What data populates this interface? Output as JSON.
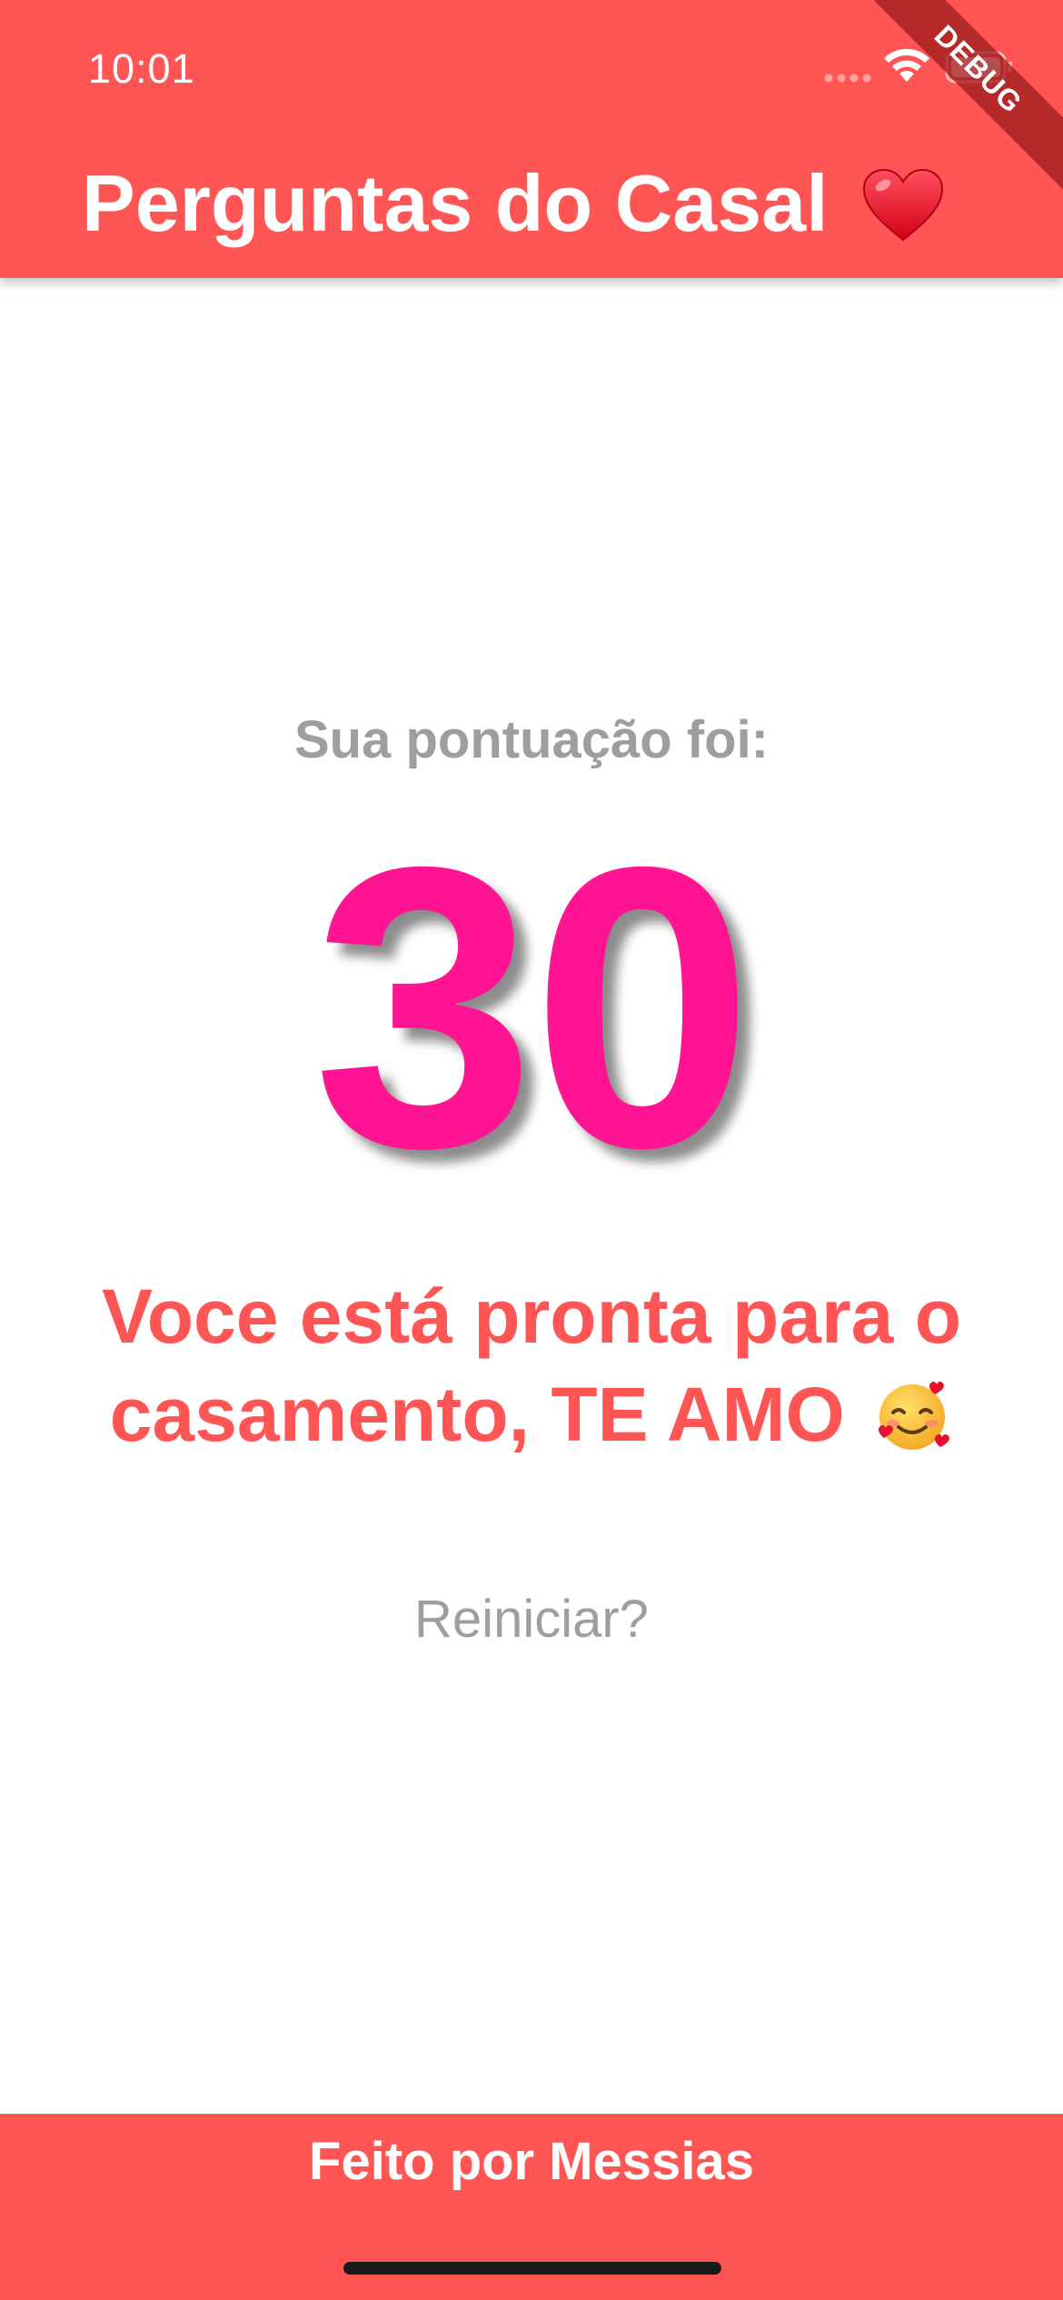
{
  "status_bar": {
    "time": "10:01"
  },
  "debug_banner": {
    "label": "DEBUG"
  },
  "app_bar": {
    "title": "Perguntas do Casal",
    "title_icon": "red-heart-emoji"
  },
  "result": {
    "score_label": "Sua pontuação foi:",
    "score": "30",
    "message": "Voce está pronta para o casamento, TE AMO",
    "message_icon": "smiling-face-with-hearts-emoji",
    "restart_label": "Reiniciar?"
  },
  "footer": {
    "text": "Feito por Messias"
  },
  "colors": {
    "primary": "#FF5555",
    "score": "#FF1493",
    "muted_text": "#9E9E9E",
    "background": "#FFFFFF"
  }
}
